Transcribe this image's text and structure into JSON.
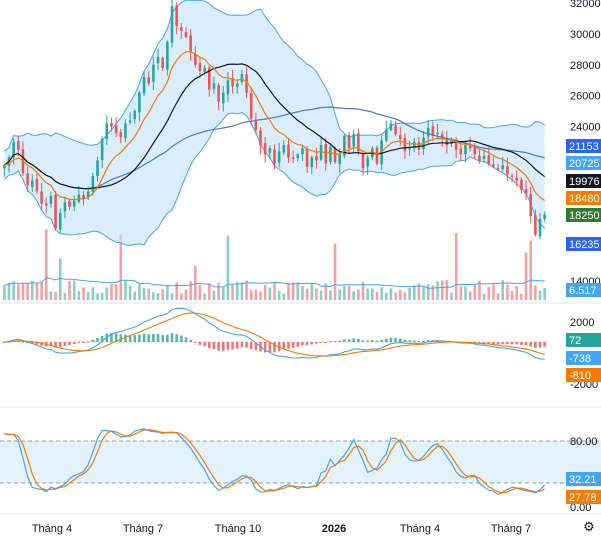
{
  "chart_data": [
    {
      "type": "candlestick",
      "panel": "price",
      "y_tick_labels": [
        "32000",
        "30000",
        "28000",
        "26000",
        "24000",
        "14000"
      ],
      "ylim": [
        14000,
        32000
      ],
      "x_tick_labels": [
        "Tháng 4",
        "Tháng 7",
        "Tháng 10",
        "2026",
        "Tháng 4",
        "Tháng 7"
      ],
      "bold_x_ticks": [
        "2026"
      ],
      "close": [
        21500,
        22000,
        23000,
        22500,
        21000,
        20200,
        20500,
        19800,
        19000,
        18900,
        19500,
        17400,
        18400,
        19100,
        18800,
        19200,
        19600,
        19300,
        19800,
        20800,
        21800,
        23200,
        24200,
        24000,
        23600,
        23300,
        24200,
        24400,
        25000,
        26200,
        27200,
        26800,
        28000,
        28500,
        27800,
        29500,
        31800,
        30500,
        30200,
        29800,
        28800,
        28000,
        27600,
        27800,
        26400,
        26800,
        25600,
        26200,
        27000,
        26600,
        26800,
        27400,
        26200,
        24500,
        23800,
        22800,
        22200,
        22600,
        21600,
        22400,
        22800,
        22000,
        21900,
        22200,
        22600,
        21400,
        22000,
        21800,
        22800,
        21600,
        22700,
        21700,
        22200,
        23400,
        22600,
        23500,
        22400,
        21300,
        22000,
        22600,
        21600,
        23100,
        23800,
        24200,
        23500,
        23200,
        22400,
        22600,
        23000,
        22500,
        23300,
        23900,
        23400,
        23600,
        23200,
        22800,
        23100,
        22500,
        22200,
        22800,
        22600,
        22200,
        21800,
        22100,
        21600,
        21400,
        21200,
        21500,
        20900,
        20800,
        20500,
        19900,
        19600,
        18200,
        17000,
        18000,
        18300
      ],
      "series": [
        {
          "name": "BB upper",
          "last": "21153"
        },
        {
          "name": "MA fast",
          "last": "20725"
        },
        {
          "name": "BB mid / MA",
          "last": "19976"
        },
        {
          "name": "MA slow",
          "last": "18480"
        },
        {
          "name": "Close",
          "last": "18250"
        },
        {
          "name": "BB lower",
          "last": "16235"
        }
      ],
      "last_close_badge": "18250",
      "badges": [
        "21153",
        "20725",
        "19976",
        "18480",
        "18250",
        "16235"
      ]
    },
    {
      "type": "bar",
      "panel": "volume",
      "badges": [
        "6.517"
      ],
      "ma_last": "6.517"
    },
    {
      "type": "line",
      "panel": "macd",
      "y_tick_labels": [
        "2000",
        "-2000"
      ],
      "ylim": [
        -2000,
        2000
      ],
      "series": [
        {
          "name": "Histogram",
          "last": "72"
        },
        {
          "name": "MACD",
          "last": "-738"
        },
        {
          "name": "Signal",
          "last": "-810"
        }
      ],
      "badges": [
        "72",
        "-738",
        "-810"
      ]
    },
    {
      "type": "line",
      "panel": "stochastic",
      "y_tick_labels": [
        "80.00",
        "0.00"
      ],
      "ylim": [
        0,
        100
      ],
      "bands": [
        20,
        80
      ],
      "series": [
        {
          "name": "%K",
          "last": "32.21"
        },
        {
          "name": "%D",
          "last": "27.78"
        }
      ],
      "badges": [
        "32.21",
        "27.78"
      ]
    }
  ],
  "colors": {
    "up": "#26a69a",
    "down": "#ef5350",
    "bollinger": "#42a5f5",
    "bollinger_fill": "#bbdefb",
    "ma_slow_line": "#4a78c9",
    "ma_orange": "#f57c00",
    "ma_black": "#131722",
    "close_badge": "#2e7d32",
    "blue_badge": "#2962ff",
    "macd_line": "#42a5f5",
    "signal_line": "#f57c00",
    "stoch_band": "#e3f2fd"
  },
  "icons": {
    "settings": "gear-icon"
  }
}
